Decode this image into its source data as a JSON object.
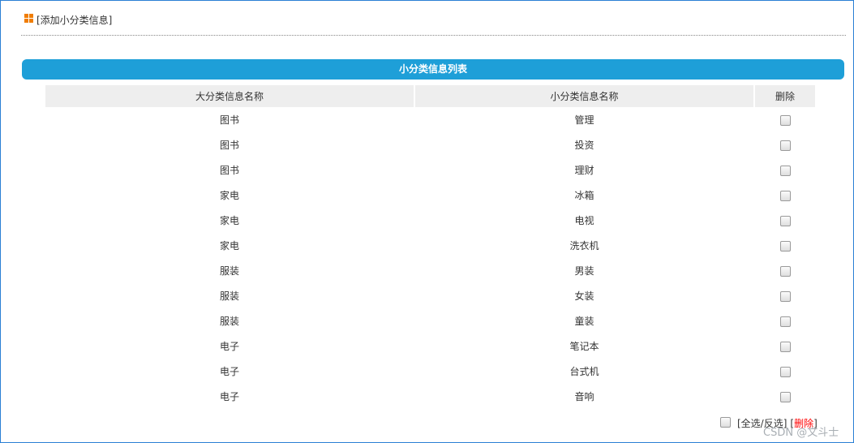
{
  "toolbar": {
    "add_label": "[添加小分类信息]"
  },
  "list_header": {
    "title": "小分类信息列表"
  },
  "table": {
    "columns": [
      "大分类信息名称",
      "小分类信息名称",
      "删除"
    ],
    "rows": [
      {
        "category": "图书",
        "subcategory": "管理"
      },
      {
        "category": "图书",
        "subcategory": "投资"
      },
      {
        "category": "图书",
        "subcategory": "理财"
      },
      {
        "category": "家电",
        "subcategory": "冰箱"
      },
      {
        "category": "家电",
        "subcategory": "电视"
      },
      {
        "category": "家电",
        "subcategory": "洗衣机"
      },
      {
        "category": "服装",
        "subcategory": "男装"
      },
      {
        "category": "服装",
        "subcategory": "女装"
      },
      {
        "category": "服装",
        "subcategory": "童装"
      },
      {
        "category": "电子",
        "subcategory": "笔记本"
      },
      {
        "category": "电子",
        "subcategory": "台式机"
      },
      {
        "category": "电子",
        "subcategory": "音响"
      }
    ]
  },
  "footer": {
    "select_all_label": "[全选/反选]",
    "bracket_open": "[",
    "delete_label": "删除",
    "bracket_close": "]"
  },
  "watermark": "CSDN @文斗士",
  "colors": {
    "frame_border": "#2b7fd4",
    "header_bar": "#1e9fd8",
    "icon": "#f07d00",
    "delete_link": "#ff0000"
  },
  "icons": {
    "toolbar_icon": "grid-icon"
  }
}
